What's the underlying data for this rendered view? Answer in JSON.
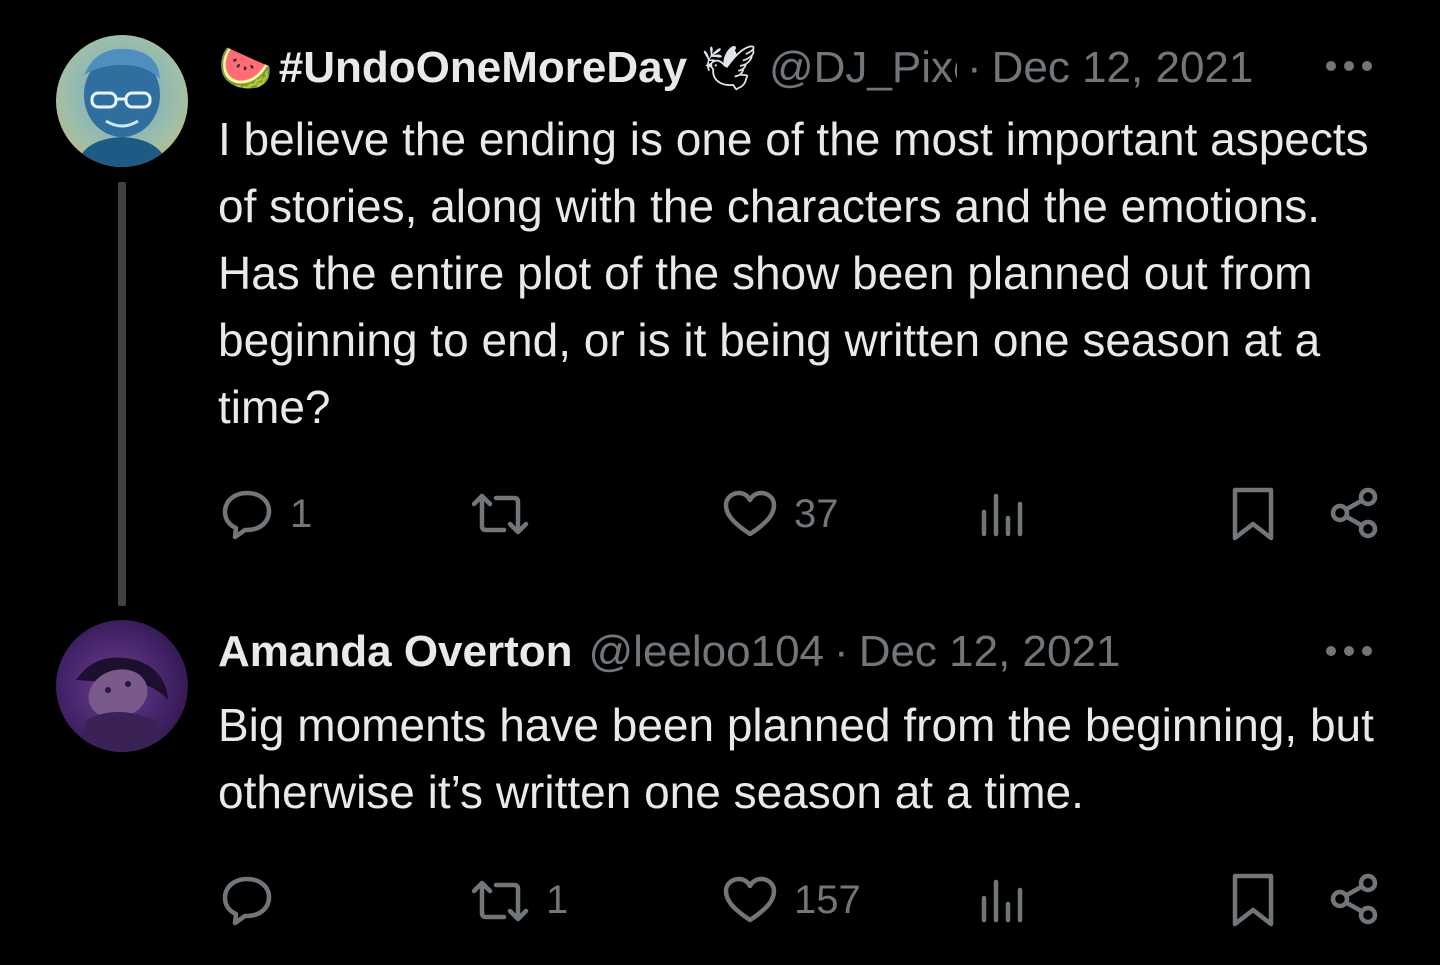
{
  "tweets": [
    {
      "display_name": "#UndoOneMoreDay",
      "emoji_before": "🍉",
      "emoji_after": "🕊",
      "handle": "@DJ_Pixel",
      "separator": "·",
      "date": "Dec 12, 2021",
      "text": "I believe the ending is one of the most important aspects of stories, along with the characters and the emotions. Has the entire plot of the show been planned out from beginning to end, or is it being written one season at a time?",
      "replies": "1",
      "retweets": "",
      "likes": "37"
    },
    {
      "display_name": "Amanda Overton",
      "handle": "@leeloo104",
      "separator": "·",
      "date": "Dec 12, 2021",
      "text": "Big moments have been planned from the beginning, but otherwise it’s written one season at a time.",
      "replies": "",
      "retweets": "1",
      "likes": "157"
    }
  ],
  "icons": {
    "reply": "speech-bubble-icon",
    "retweet": "retweet-arrows-icon",
    "like": "heart-icon",
    "views": "bar-chart-icon",
    "bookmark": "bookmark-icon",
    "share": "share-icon",
    "more": "more-horizontal-icon"
  },
  "colors": {
    "background": "#000000",
    "text": "#e7e9ea",
    "secondary": "#71767b",
    "thread_line": "#3e4144"
  }
}
